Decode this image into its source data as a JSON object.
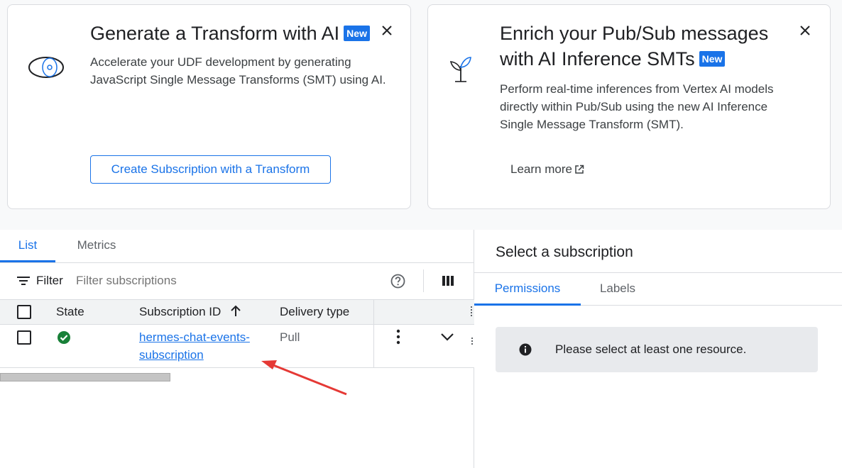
{
  "promo_cards": [
    {
      "title": "Generate a Transform with AI",
      "badge": "New",
      "description": "Accelerate your UDF development by generating JavaScript Single Message Transforms (SMT) using AI.",
      "button_label": "Create Subscription with a Transform",
      "icon": "eye-icon"
    },
    {
      "title_line1": "Enrich your Pub/Sub messages",
      "title_line2": "with AI Inference SMTs",
      "badge": "New",
      "description": "Perform real-time inferences from Vertex AI models directly within Pub/Sub using the new AI Inference Single Message Transform (SMT).",
      "link_label": "Learn more",
      "icon": "sprout-icon"
    }
  ],
  "list_panel": {
    "tabs": [
      {
        "label": "List",
        "active": true
      },
      {
        "label": "Metrics",
        "active": false
      }
    ],
    "filter": {
      "label": "Filter",
      "placeholder": "Filter subscriptions"
    },
    "columns": [
      "State",
      "Subscription ID",
      "Delivery type"
    ],
    "sort_indicator": "↑",
    "rows": [
      {
        "state": "success",
        "subscription_id": "hermes-chat-events-subscription",
        "delivery_type": "Pull"
      }
    ]
  },
  "detail_panel": {
    "title": "Select a subscription",
    "tabs": [
      {
        "label": "Permissions",
        "active": true
      },
      {
        "label": "Labels",
        "active": false
      }
    ],
    "info_message": "Please select at least one resource."
  },
  "colors": {
    "accent": "#1a73e8",
    "success": "#188038",
    "annotation": "#e53935"
  }
}
